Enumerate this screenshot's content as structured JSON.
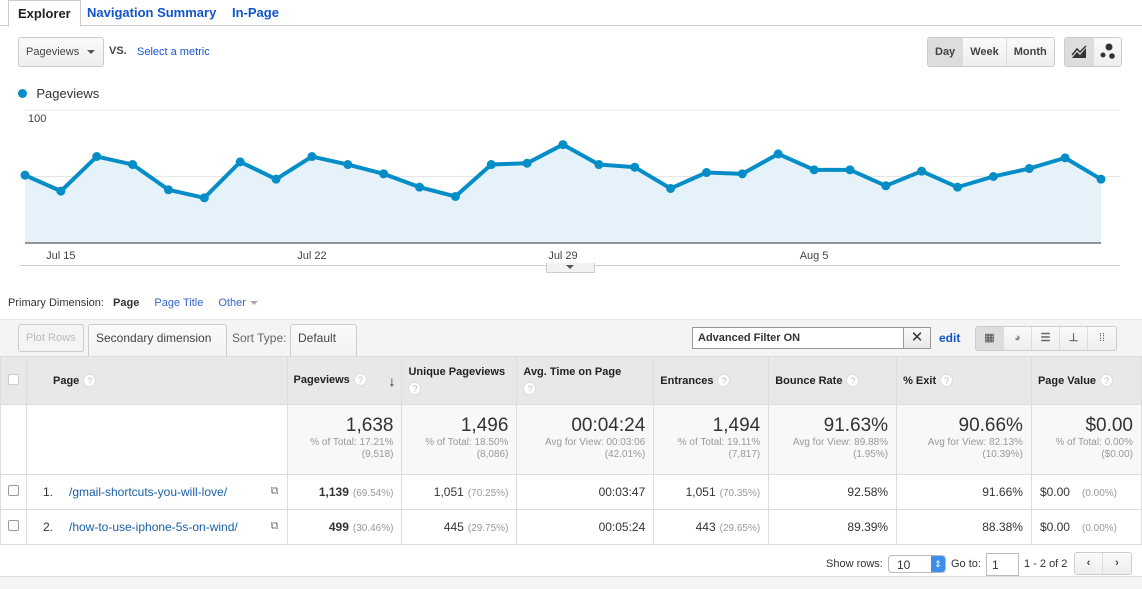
{
  "tabs": [
    {
      "label": "Explorer",
      "active": true
    },
    {
      "label": "Navigation Summary"
    },
    {
      "label": "In-Page"
    }
  ],
  "metric_select": {
    "value": "Pageviews",
    "vs": "VS.",
    "compare_link": "Select a metric"
  },
  "granularity": {
    "options": [
      "Day",
      "Week",
      "Month"
    ],
    "selected": "Day"
  },
  "chart_type_icons": [
    "line-chart-icon",
    "motion-chart-icon"
  ],
  "accent_color": "#058dc7",
  "chart_data": {
    "type": "area",
    "legend": [
      "Pageviews"
    ],
    "legend_placement": "top-left",
    "ylim": [
      0,
      100
    ],
    "yticks": [
      "100",
      "50"
    ],
    "grid": true,
    "xticks": [
      {
        "label": "Jul 15",
        "index": 1
      },
      {
        "label": "Jul 22",
        "index": 8
      },
      {
        "label": "Jul 29",
        "index": 15
      },
      {
        "label": "Aug 5",
        "index": 22
      }
    ],
    "dates": [
      "Jul 14",
      "Jul 15",
      "Jul 16",
      "Jul 17",
      "Jul 18",
      "Jul 19",
      "Jul 20",
      "Jul 21",
      "Jul 22",
      "Jul 23",
      "Jul 24",
      "Jul 25",
      "Jul 26",
      "Jul 27",
      "Jul 28",
      "Jul 29",
      "Jul 30",
      "Jul 31",
      "Aug 1",
      "Aug 2",
      "Aug 3",
      "Aug 4",
      "Aug 5",
      "Aug 6",
      "Aug 7",
      "Aug 8",
      "Aug 9",
      "Aug 10",
      "Aug 11",
      "Aug 12",
      "Aug 13"
    ],
    "series": [
      {
        "name": "Pageviews",
        "values": [
          51,
          39,
          65,
          59,
          40,
          34,
          61,
          48,
          65,
          59,
          52,
          42,
          35,
          59,
          60,
          74,
          59,
          57,
          41,
          53,
          52,
          67,
          55,
          55,
          43,
          54,
          42,
          50,
          56,
          64,
          48
        ]
      }
    ]
  },
  "primary_dimension": {
    "label": "Primary Dimension:",
    "selected": "Page",
    "options": [
      "Page Title",
      "Other"
    ]
  },
  "controls": {
    "plot_rows": "Plot Rows",
    "secondary": "Secondary dimension",
    "sort_label": "Sort Type:",
    "sort_value": "Default",
    "filter": "Advanced Filter ON",
    "edit": "edit"
  },
  "table": {
    "headers": [
      "Page",
      "Pageviews",
      "Unique Pageviews",
      "Avg. Time on Page",
      "Entrances",
      "Bounce Rate",
      "% Exit",
      "Page Value"
    ],
    "totals": [
      {
        "v": "1,638",
        "s1": "% of Total: 17.21%",
        "s2": "(9,518)"
      },
      {
        "v": "1,496",
        "s1": "% of Total: 18.50%",
        "s2": "(8,086)"
      },
      {
        "v": "00:04:24",
        "s1": "Avg for View: 00:03:06",
        "s2": "(42.01%)"
      },
      {
        "v": "1,494",
        "s1": "% of Total: 19.11%",
        "s2": "(7,817)"
      },
      {
        "v": "91.63%",
        "s1": "Avg for View: 89.88%",
        "s2": "(1.95%)"
      },
      {
        "v": "90.66%",
        "s1": "Avg for View: 82.13%",
        "s2": "(10.39%)"
      },
      {
        "v": "$0.00",
        "s1": "% of Total: 0.00%",
        "s2": "($0.00)"
      }
    ],
    "rows": [
      {
        "num": "1.",
        "page": "/gmail-shortcuts-you-will-love/",
        "pv": "1,139",
        "pvp": "(69.54%)",
        "up": "1,051",
        "upp": "(70.25%)",
        "time": "00:03:47",
        "ent": "1,051",
        "entp": "(70.35%)",
        "br": "92.58%",
        "exit": "91.66%",
        "val": "$0.00",
        "valp": "(0.00%)"
      },
      {
        "num": "2.",
        "page": "/how-to-use-iphone-5s-on-wind/",
        "pv": "499",
        "pvp": "(30.46%)",
        "up": "445",
        "upp": "(29.75%)",
        "time": "00:05:24",
        "ent": "443",
        "entp": "(29.65%)",
        "br": "89.39%",
        "exit": "88.38%",
        "val": "$0.00",
        "valp": "(0.00%)"
      }
    ]
  },
  "pagination": {
    "show_rows_label": "Show rows:",
    "show_rows": "10",
    "goto_label": "Go to:",
    "goto": "1",
    "range": "1 - 2 of 2"
  }
}
